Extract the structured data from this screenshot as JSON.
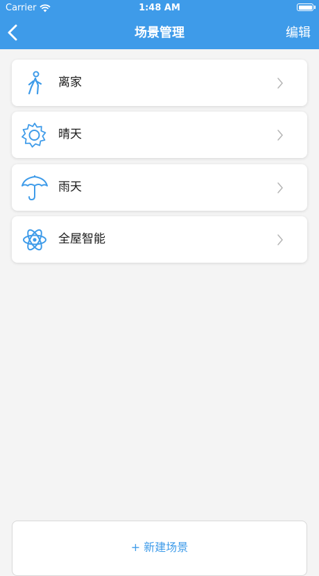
{
  "status_bar": {
    "carrier": "Carrier",
    "time": "1:48 AM"
  },
  "nav": {
    "title": "场景管理",
    "edit_label": "编辑"
  },
  "scenes": [
    {
      "label": "离家",
      "icon": "walking-person-icon"
    },
    {
      "label": "晴天",
      "icon": "sun-icon"
    },
    {
      "label": "雨天",
      "icon": "umbrella-icon"
    },
    {
      "label": "全屋智能",
      "icon": "atom-icon"
    }
  ],
  "new_scene_label": "+ 新建场景",
  "colors": {
    "accent": "#3e9be9",
    "background": "#f4f4f4"
  }
}
